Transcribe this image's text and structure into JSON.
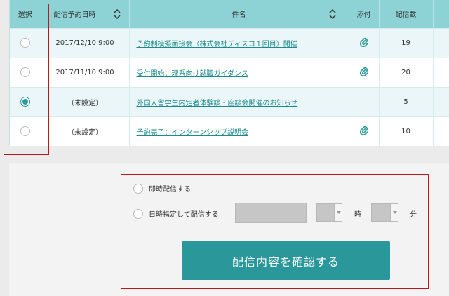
{
  "table": {
    "headers": {
      "select": "選択",
      "scheduled": "配信予約日時",
      "subject": "件名",
      "attachment": "添付",
      "count": "配信数"
    },
    "rows": [
      {
        "date": "2017/12/10 9:00",
        "subject": "予約制模擬面接会（株式会社ディスコ１回目）開催",
        "attachment": true,
        "count": "19",
        "selected": false
      },
      {
        "date": "2017/11/10 9:00",
        "subject": "受付開始：理系向け就職ガイダンス",
        "attachment": true,
        "count": "20",
        "selected": false
      },
      {
        "date": "（未設定）",
        "subject": "外国人留学生内定者体験談・座談会開催のお知らせ",
        "attachment": false,
        "count": "5",
        "selected": true
      },
      {
        "date": "（未設定）",
        "subject": "予約完了：インターンシップ説明会",
        "attachment": true,
        "count": "10",
        "selected": false
      }
    ]
  },
  "delivery": {
    "immediate_label": "即時配信する",
    "scheduled_label": "日時指定して配信する",
    "hour_unit": "時",
    "minute_unit": "分",
    "confirm_label": "配信内容を確認する"
  },
  "colors": {
    "header_bg": "#8dd3d6",
    "accent": "#2a979b",
    "link": "#1d8a8e",
    "highlight_border": "#c0161c"
  }
}
